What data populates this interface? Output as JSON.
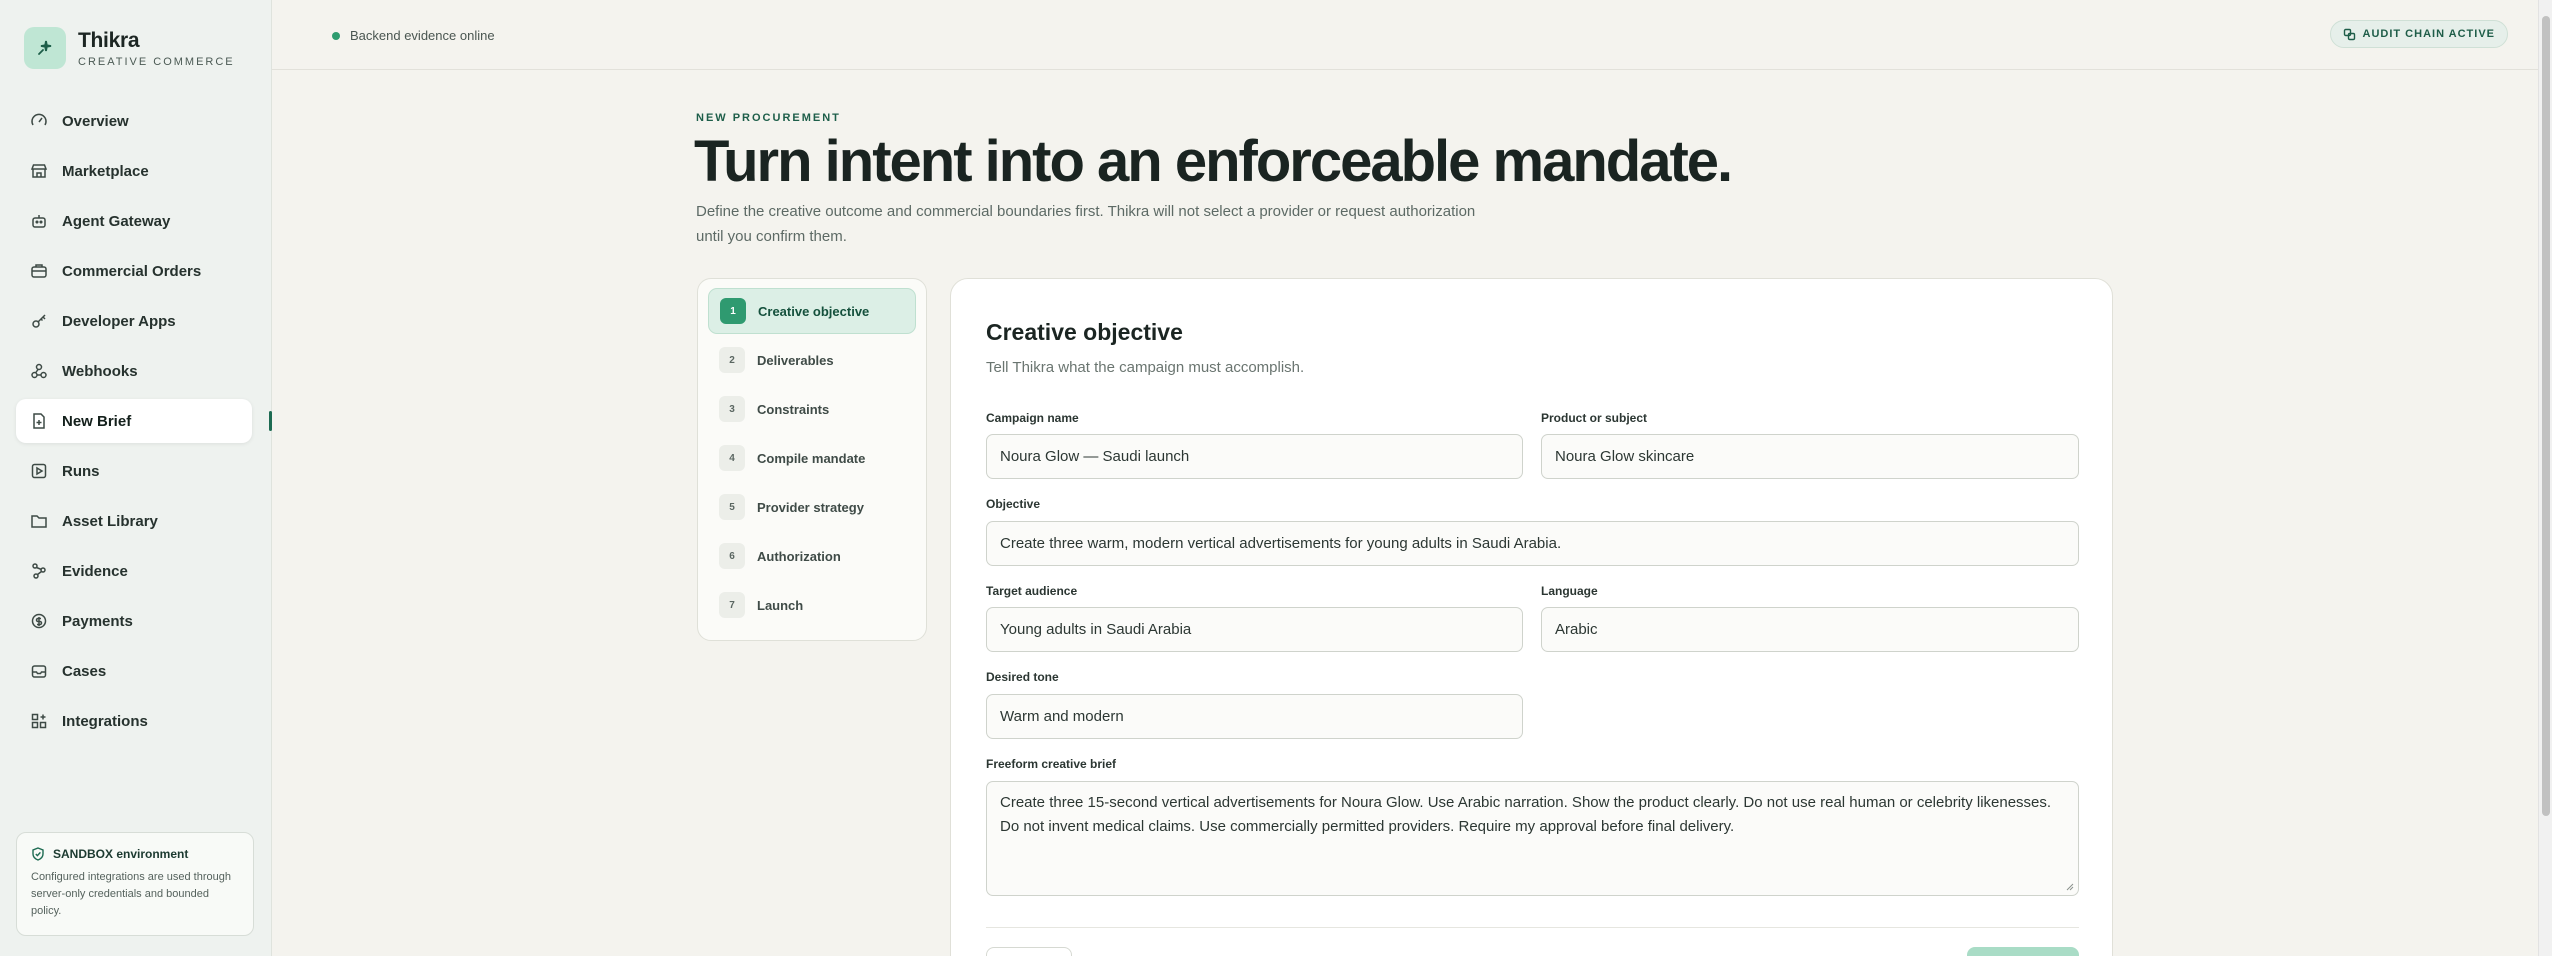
{
  "brand": {
    "name": "Thikra",
    "subtitle": "CREATIVE COMMERCE"
  },
  "sidebar": {
    "items": [
      {
        "label": "Overview",
        "icon": "gauge-icon"
      },
      {
        "label": "Marketplace",
        "icon": "store-icon"
      },
      {
        "label": "Agent Gateway",
        "icon": "bot-icon"
      },
      {
        "label": "Commercial Orders",
        "icon": "briefcase-icon"
      },
      {
        "label": "Developer Apps",
        "icon": "key-icon"
      },
      {
        "label": "Webhooks",
        "icon": "webhook-icon"
      },
      {
        "label": "New Brief",
        "icon": "file-plus-icon",
        "active": true
      },
      {
        "label": "Runs",
        "icon": "play-square-icon"
      },
      {
        "label": "Asset Library",
        "icon": "folder-icon"
      },
      {
        "label": "Evidence",
        "icon": "network-icon"
      },
      {
        "label": "Payments",
        "icon": "coin-icon"
      },
      {
        "label": "Cases",
        "icon": "inbox-icon"
      },
      {
        "label": "Integrations",
        "icon": "grid-plus-icon"
      }
    ],
    "sandbox": {
      "title": "SANDBOX environment",
      "body": "Configured integrations are used through server-only credentials and bounded policy."
    }
  },
  "topbar": {
    "status": "Backend evidence online",
    "audit_badge": "AUDIT CHAIN ACTIVE"
  },
  "hero": {
    "eyebrow": "NEW PROCUREMENT",
    "title": "Turn intent into an enforceable mandate.",
    "description": "Define the creative outcome and commercial boundaries first. Thikra will not select a provider or request authorization until you confirm them."
  },
  "steps": [
    {
      "num": "1",
      "label": "Creative objective",
      "active": true
    },
    {
      "num": "2",
      "label": "Deliverables"
    },
    {
      "num": "3",
      "label": "Constraints"
    },
    {
      "num": "4",
      "label": "Compile mandate"
    },
    {
      "num": "5",
      "label": "Provider strategy"
    },
    {
      "num": "6",
      "label": "Authorization"
    },
    {
      "num": "7",
      "label": "Launch"
    }
  ],
  "form": {
    "title": "Creative objective",
    "subtitle": "Tell Thikra what the campaign must accomplish.",
    "campaign_name": {
      "label": "Campaign name",
      "value": "Noura Glow — Saudi launch"
    },
    "product": {
      "label": "Product or subject",
      "value": "Noura Glow skincare"
    },
    "objective": {
      "label": "Objective",
      "value": "Create three warm, modern vertical advertisements for young adults in Saudi Arabia."
    },
    "audience": {
      "label": "Target audience",
      "value": "Young adults in Saudi Arabia"
    },
    "language": {
      "label": "Language",
      "value": "Arabic"
    },
    "tone": {
      "label": "Desired tone",
      "value": "Warm and modern"
    },
    "brief": {
      "label": "Freeform creative brief",
      "value": "Create three 15-second vertical advertisements for Noura Glow. Use Arabic narration. Show the product clearly. Do not use real human or celebrity likenesses. Do not invent medical claims. Use commercially permitted providers. Require my approval before final delivery."
    }
  },
  "colors": {
    "accent": "#1d6b52",
    "accent_light": "#dcefe6",
    "status_online": "#2e9c6f"
  }
}
